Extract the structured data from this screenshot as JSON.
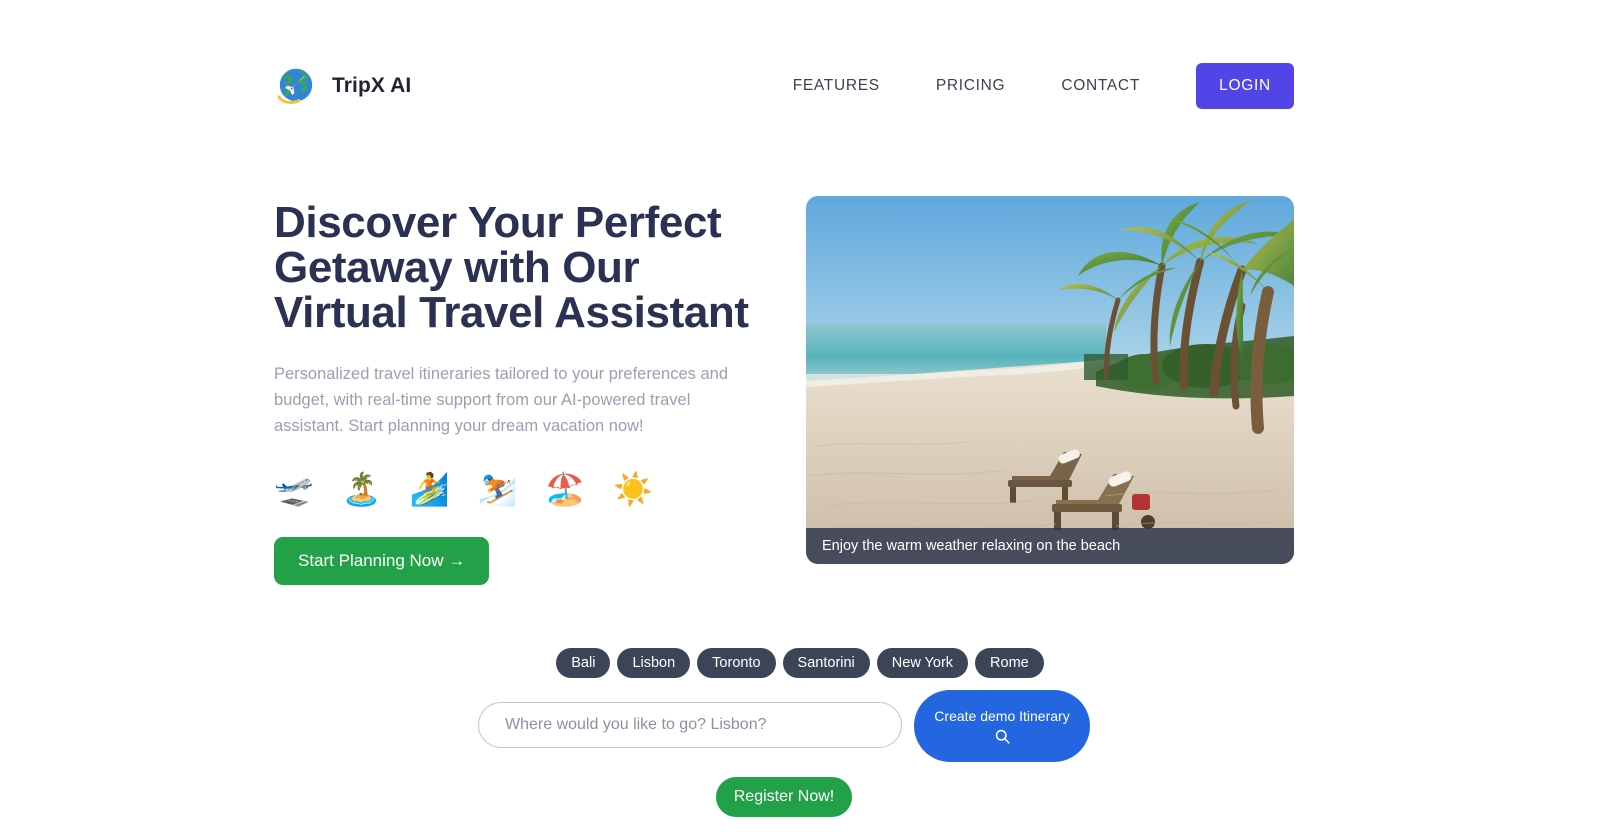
{
  "brand": {
    "name": "TripX AI",
    "logo_icon": "globe-airplane-icon"
  },
  "nav": {
    "items": [
      {
        "label": "FEATURES"
      },
      {
        "label": "PRICING"
      },
      {
        "label": "CONTACT"
      }
    ],
    "login_label": "LOGIN",
    "login_color": "#5145e8"
  },
  "hero": {
    "title": "Discover Your Perfect Getaway with Our Virtual Travel Assistant",
    "subtitle": "Personalized travel itineraries tailored to your preferences and budget, with real-time support from our AI-powered travel assistant. Start planning your dream vacation now!",
    "emojis": [
      {
        "name": "airplane-departure-icon",
        "glyph": "🛫"
      },
      {
        "name": "desert-island-icon",
        "glyph": "🏝️"
      },
      {
        "name": "surfer-icon",
        "glyph": "🏄"
      },
      {
        "name": "skier-icon",
        "glyph": "⛷️"
      },
      {
        "name": "beach-umbrella-icon",
        "glyph": "🏖️"
      },
      {
        "name": "sun-icon",
        "glyph": "☀️"
      }
    ],
    "cta_label": "Start Planning Now →",
    "cta_color": "#22a148",
    "image_caption": "Enjoy the warm weather relaxing on the beach",
    "image_alt": "Tropical beach with palm trees and two lounge chairs on white sand"
  },
  "destinations": {
    "chips": [
      {
        "label": "Bali"
      },
      {
        "label": "Lisbon"
      },
      {
        "label": "Toronto"
      },
      {
        "label": "Santorini"
      },
      {
        "label": "New York"
      },
      {
        "label": "Rome"
      }
    ],
    "chip_color": "#3c4458"
  },
  "search": {
    "placeholder": "Where would you like to go? Lisbon?",
    "value": "",
    "demo_button_label": "Create demo Itinerary",
    "demo_button_icon": "search-icon",
    "demo_button_color": "#2466e0"
  },
  "register": {
    "label": "Register Now!",
    "color": "#22a148"
  }
}
